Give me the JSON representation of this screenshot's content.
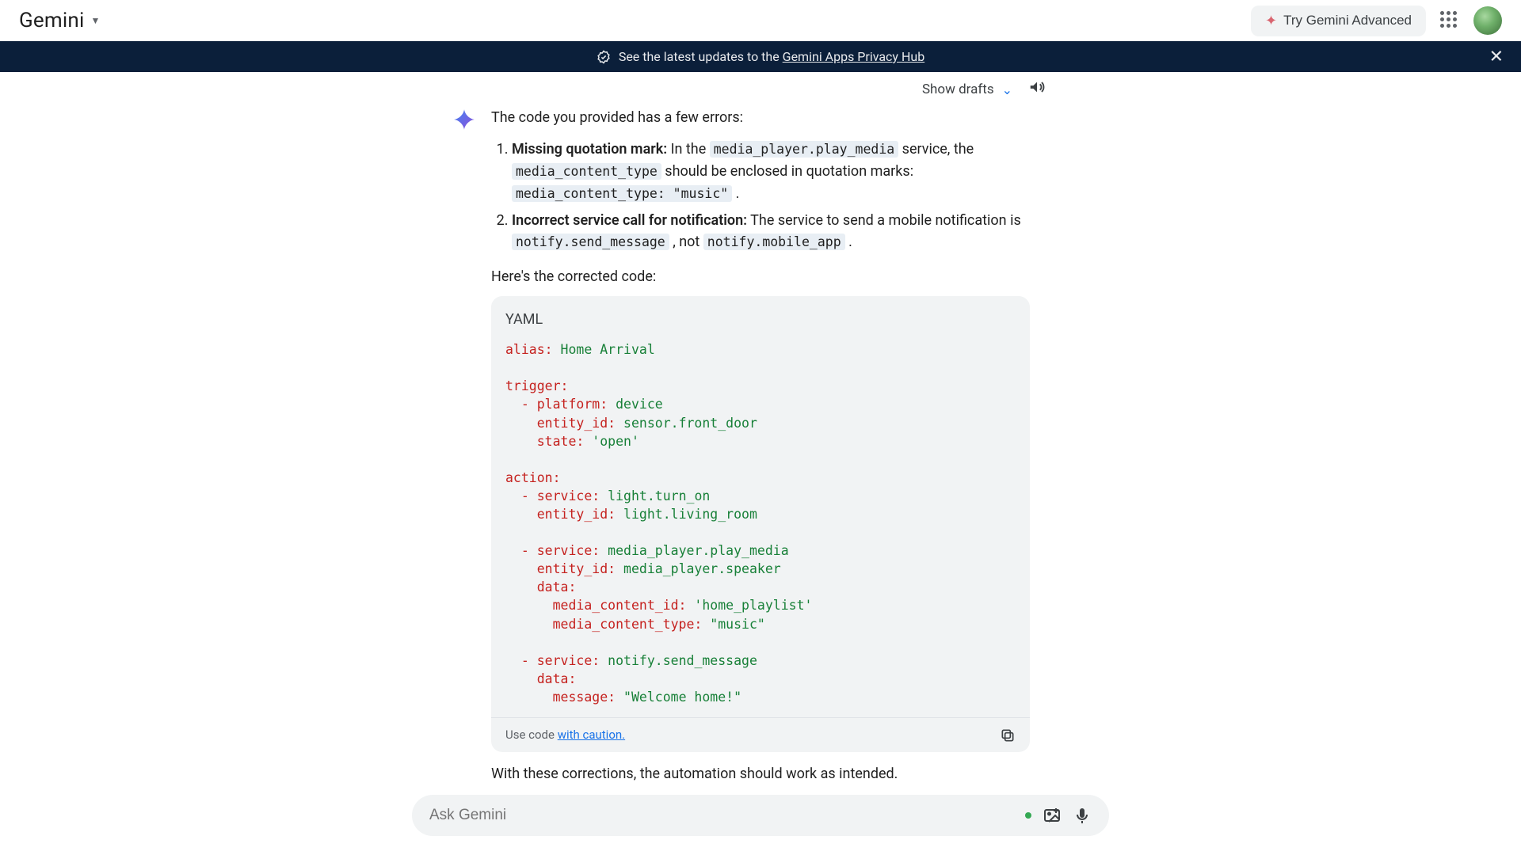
{
  "header": {
    "logo": "Gemini",
    "try_label": "Try Gemini Advanced"
  },
  "banner": {
    "prefix": "See the latest updates to the ",
    "link_text": "Gemini Apps Privacy Hub"
  },
  "toolbar": {
    "show_drafts": "Show drafts"
  },
  "response": {
    "intro": "The code you provided has a few errors:",
    "errors": [
      {
        "title": "Missing quotation mark:",
        "before1": " In the ",
        "code1": "media_player.play_media",
        "after1": " service, the ",
        "code2": "media_content_type",
        "after2": " should be enclosed in quotation marks: ",
        "code3": "media_content_type: \"music\"",
        "after3": " ."
      },
      {
        "title": "Incorrect service call for notification:",
        "before1": " The service to send a mobile notification is ",
        "code1": "notify.send_message",
        "after1": " , not ",
        "code2": "notify.mobile_app",
        "after2": " ."
      }
    ],
    "corrected_label": "Here's the corrected code:",
    "code_lang": "YAML",
    "code_footer_prefix": "Use code ",
    "code_footer_link": "with caution.",
    "closing": "With these corrections, the automation should work as intended."
  },
  "code": {
    "alias_k": "alias:",
    "alias_v": " Home Arrival",
    "trigger_k": "trigger:",
    "platform_k": "platform:",
    "platform_v": " device",
    "entity_k": "entity_id:",
    "trig_entity_v": " sensor.front_door",
    "state_k": "state:",
    "state_v": " 'open'",
    "action_k": "action:",
    "svc_k": "service:",
    "svc1_v": " light.turn_on",
    "ent1_v": " light.living_room",
    "svc2_v": " media_player.play_media",
    "ent2_v": " media_player.speaker",
    "data_k": "data:",
    "mcid_k": "media_content_id:",
    "mcid_v": " 'home_playlist'",
    "mct_k": "media_content_type:",
    "mct_v": " \"music\"",
    "svc3_v": " notify.send_message",
    "msg_k": "message:",
    "msg_v": " \"Welcome home!\""
  },
  "prompt": {
    "placeholder": "Ask Gemini"
  }
}
